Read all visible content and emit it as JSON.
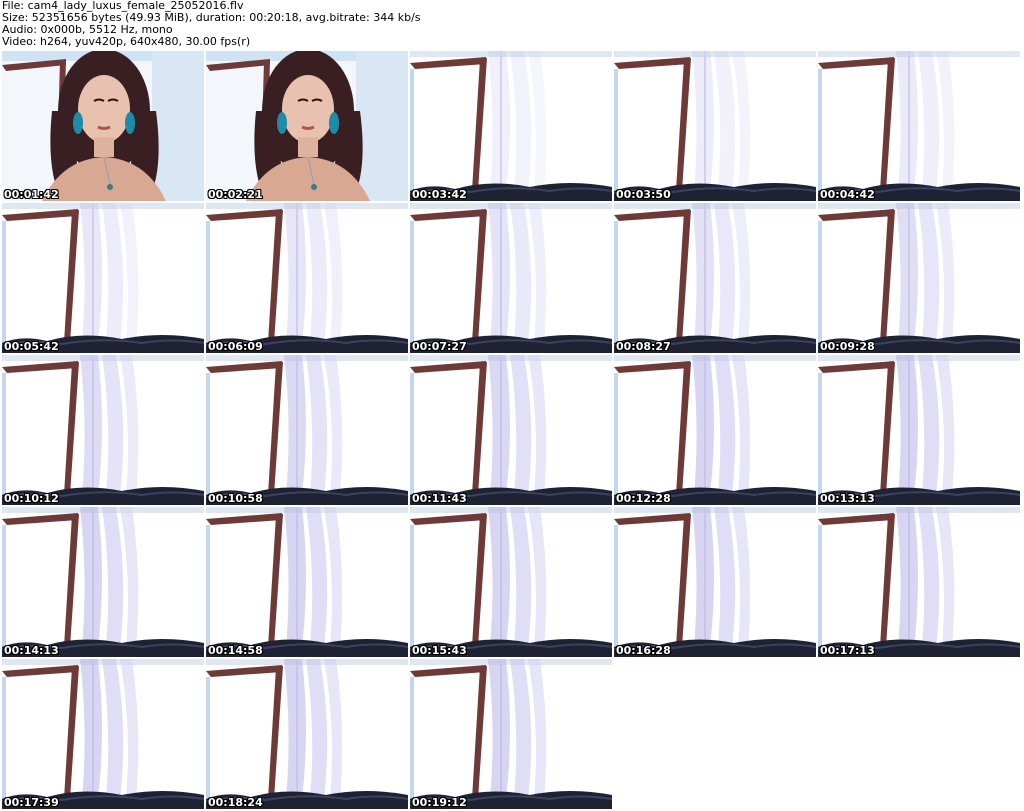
{
  "header": {
    "file_line": "File: cam4_lady_luxus_female_25052016.flv",
    "size_line": "Size: 52351656 bytes (49.93 MiB), duration: 00:20:18, avg.bitrate: 344 kb/s",
    "audio_line": "Audio: 0x000b, 5512 Hz, mono",
    "video_line": "Video: h264, yuv420p, 640x480, 30.00 fps(r)"
  },
  "thumbnails": [
    {
      "timestamp": "00:01:42",
      "scene": "person"
    },
    {
      "timestamp": "00:02:21",
      "scene": "person"
    },
    {
      "timestamp": "00:03:42",
      "scene": "window"
    },
    {
      "timestamp": "00:03:50",
      "scene": "window"
    },
    {
      "timestamp": "00:04:42",
      "scene": "window"
    },
    {
      "timestamp": "00:05:42",
      "scene": "window"
    },
    {
      "timestamp": "00:06:09",
      "scene": "window"
    },
    {
      "timestamp": "00:07:27",
      "scene": "window"
    },
    {
      "timestamp": "00:08:27",
      "scene": "window"
    },
    {
      "timestamp": "00:09:28",
      "scene": "window"
    },
    {
      "timestamp": "00:10:12",
      "scene": "window"
    },
    {
      "timestamp": "00:10:58",
      "scene": "window"
    },
    {
      "timestamp": "00:11:43",
      "scene": "window"
    },
    {
      "timestamp": "00:12:28",
      "scene": "window"
    },
    {
      "timestamp": "00:13:13",
      "scene": "window"
    },
    {
      "timestamp": "00:14:13",
      "scene": "window"
    },
    {
      "timestamp": "00:14:58",
      "scene": "window"
    },
    {
      "timestamp": "00:15:43",
      "scene": "window"
    },
    {
      "timestamp": "00:16:28",
      "scene": "window"
    },
    {
      "timestamp": "00:17:13",
      "scene": "window"
    },
    {
      "timestamp": "00:17:39",
      "scene": "window"
    },
    {
      "timestamp": "00:18:24",
      "scene": "window"
    },
    {
      "timestamp": "00:19:12",
      "scene": "window"
    }
  ]
}
